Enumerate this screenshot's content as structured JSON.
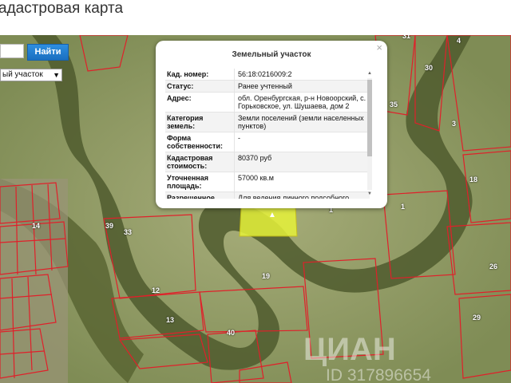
{
  "page": {
    "title": "адастровая карта"
  },
  "search": {
    "value": "",
    "button_label": "Найти"
  },
  "layer_select": {
    "selected": "ый участок"
  },
  "popup": {
    "title": "Земельный участок",
    "close_glyph": "×",
    "rows": [
      {
        "label": "Кад. номер:",
        "value": "56:18:0216009:2"
      },
      {
        "label": "Статус:",
        "value": "Ранее учтенный"
      },
      {
        "label": "Адрес:",
        "value": "обл. Оренбургская, р-н Новоорский, с. Горьковское, ул. Шушаева, дом 2"
      },
      {
        "label": "Категория земель:",
        "value": "Земли поселений (земли населенных пунктов)"
      },
      {
        "label": "Форма собственности:",
        "value": "-"
      },
      {
        "label": "Кадастровая стоимость:",
        "value": "80370 руб"
      },
      {
        "label": "Уточненная площадь:",
        "value": "57000 кв.м"
      },
      {
        "label": "Разрешенное",
        "value": "Для ведения личного подсобного"
      }
    ]
  },
  "parcels": [
    {
      "num": "31"
    },
    {
      "num": "4"
    },
    {
      "num": "30"
    },
    {
      "num": "35"
    },
    {
      "num": "3"
    },
    {
      "num": "18"
    },
    {
      "num": "1"
    },
    {
      "num": "1"
    },
    {
      "num": "39"
    },
    {
      "num": "33"
    },
    {
      "num": "14"
    },
    {
      "num": "19"
    },
    {
      "num": "12"
    },
    {
      "num": "13"
    },
    {
      "num": "40"
    },
    {
      "num": "26"
    },
    {
      "num": "29"
    }
  ],
  "watermark": {
    "brand": "ЦИАН",
    "id": "ID 317896654"
  },
  "colors": {
    "parcel_border": "#e0202a",
    "selected_fill": "#e6f23a",
    "button": "#1f7ad0"
  },
  "icons": {
    "close": "close-icon",
    "marker": "map-marker-icon",
    "chevron": "chevron-down-icon"
  }
}
